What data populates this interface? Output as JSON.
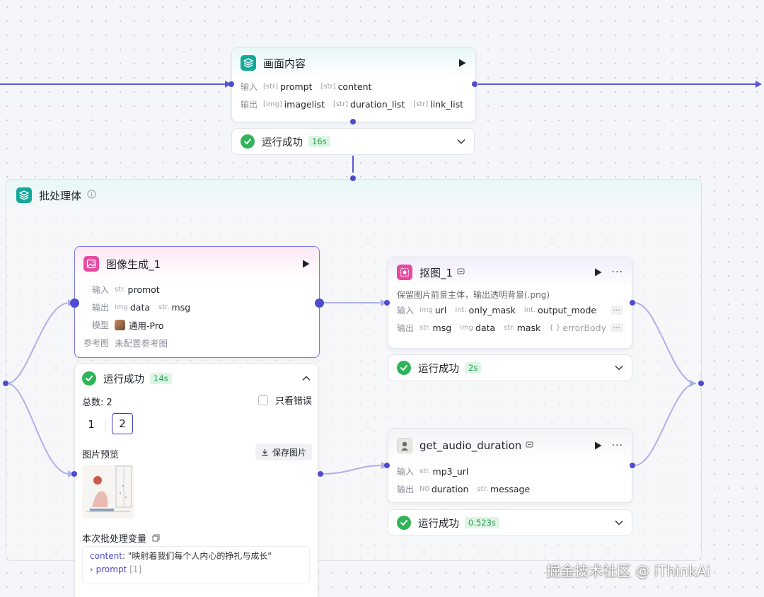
{
  "top_node": {
    "title": "画面内容",
    "input_label": "输入",
    "output_label": "输出",
    "inputs": [
      {
        "type": "[str]",
        "name": "prompt"
      },
      {
        "type": "[str]",
        "name": "content"
      }
    ],
    "outputs": [
      {
        "type": "[img]",
        "name": "imagelist"
      },
      {
        "type": "[str]",
        "name": "duration_list"
      },
      {
        "type": "[str]",
        "name": "link_list"
      }
    ],
    "status": "运行成功",
    "duration": "16s"
  },
  "batch": {
    "title": "批处理体"
  },
  "image_node": {
    "title": "图像生成_1",
    "input_label": "输入",
    "output_label": "输出",
    "model_label": "模型",
    "ref_label": "参考图",
    "input": {
      "type": "str.",
      "name": "promot"
    },
    "outputs": [
      {
        "type": "img",
        "name": "data"
      },
      {
        "type": "str.",
        "name": "msg"
      }
    ],
    "model_value": "通用-Pro",
    "ref_value": "未配置参考图",
    "status": "运行成功",
    "duration": "14s",
    "total": "总数: 2",
    "only_errors": "只看错误",
    "pages": [
      "1",
      "2"
    ],
    "preview_label": "图片预览",
    "save_label": "保存图片",
    "vars_label": "本次批处理变量",
    "var_content_key": "content",
    "var_content_value": ": \"映射着我们每个人内心的挣扎与成长\"",
    "var_prompt_key": "prompt",
    "var_prompt_count": "[1]"
  },
  "cutout_node": {
    "title": "抠图_1",
    "description": "保留图片前景主体，输出透明背景(.png)",
    "input_label": "输入",
    "output_label": "输出",
    "inputs": [
      {
        "type": "img",
        "name": "url"
      },
      {
        "type": "int.",
        "name": "only_mask"
      },
      {
        "type": "int.",
        "name": "output_mode"
      }
    ],
    "outputs": [
      {
        "type": "str.",
        "name": "msg"
      },
      {
        "type": "img",
        "name": "data"
      },
      {
        "type": "str.",
        "name": "mask"
      },
      {
        "type": "{ }",
        "name": "errorBody"
      }
    ],
    "more": "···",
    "status": "运行成功",
    "duration": "2s"
  },
  "audio_node": {
    "title": "get_audio_duration",
    "input_label": "输入",
    "output_label": "输出",
    "input": {
      "type": "str.",
      "name": "mp3_url"
    },
    "outputs": [
      {
        "type": "N0",
        "name": "duration"
      },
      {
        "type": "str.",
        "name": "message"
      }
    ],
    "status": "运行成功",
    "duration": "0.523s"
  },
  "watermark": "掘金技术社区 @ iThinkAi",
  "colors": {
    "accent": "#4f4bd0",
    "success": "#2fb45a",
    "teal_icon": "#14a89a",
    "pink_icon": "#e64aa0"
  }
}
